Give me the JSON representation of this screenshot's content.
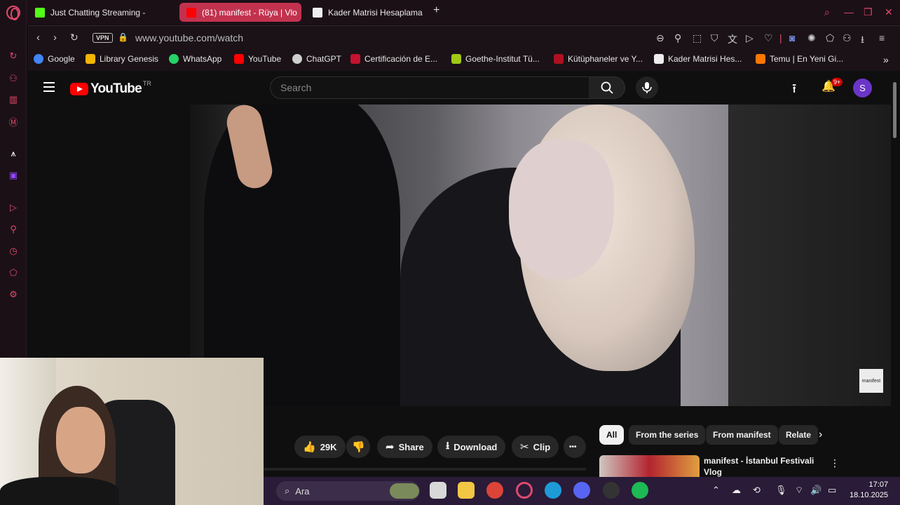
{
  "browser": {
    "tabs": [
      {
        "title": "Just Chatting Streaming -",
        "favicon_color": "#53fc18",
        "active": false
      },
      {
        "title": "(81) manifest - Rüya | Vlo",
        "favicon_color": "#ff0000",
        "active": true
      },
      {
        "title": "Kader Matrisi Hesaplama",
        "favicon_color": "#eeeeee",
        "active": false
      }
    ],
    "new_tab": "+",
    "address": {
      "vpn_label": "VPN",
      "url": "www.youtube.com/watch"
    },
    "bookmarks": [
      {
        "label": "Google",
        "favicon_color": "#4285f4"
      },
      {
        "label": "Library Genesis",
        "favicon_color": "#f4b400"
      },
      {
        "label": "WhatsApp",
        "favicon_color": "#25d366"
      },
      {
        "label": "YouTube",
        "favicon_color": "#ff0000"
      },
      {
        "label": "ChatGPT",
        "favicon_color": "#cfcfcf"
      },
      {
        "label": "Certificación de E...",
        "favicon_color": "#c4122f"
      },
      {
        "label": "Goethe-Institut Tü...",
        "favicon_color": "#a0c814"
      },
      {
        "label": "Kütüphaneler ve Y...",
        "favicon_color": "#b01020"
      },
      {
        "label": "Kader Matrisi Hes...",
        "favicon_color": "#eeeeee"
      },
      {
        "label": "Temu | En Yeni Gi...",
        "favicon_color": "#fb7701"
      }
    ],
    "accent": "#e04a6b"
  },
  "youtube": {
    "logo_text": "YouTube",
    "country_code": "TR",
    "search_placeholder": "Search",
    "notification_badge": "9+",
    "avatar_letter": "S",
    "actions": {
      "likes": "29K",
      "share": "Share",
      "download": "Download",
      "clip": "Clip",
      "more": "•••"
    },
    "chips": [
      "All",
      "From the series",
      "From manifest",
      "Relate"
    ],
    "recommendation": {
      "title": "manifest - İstanbul Festivali Vlog"
    },
    "watermark": "manifest"
  },
  "taskbar": {
    "search_label": "Ara",
    "time": "17:07",
    "date": "18.10.2025"
  }
}
